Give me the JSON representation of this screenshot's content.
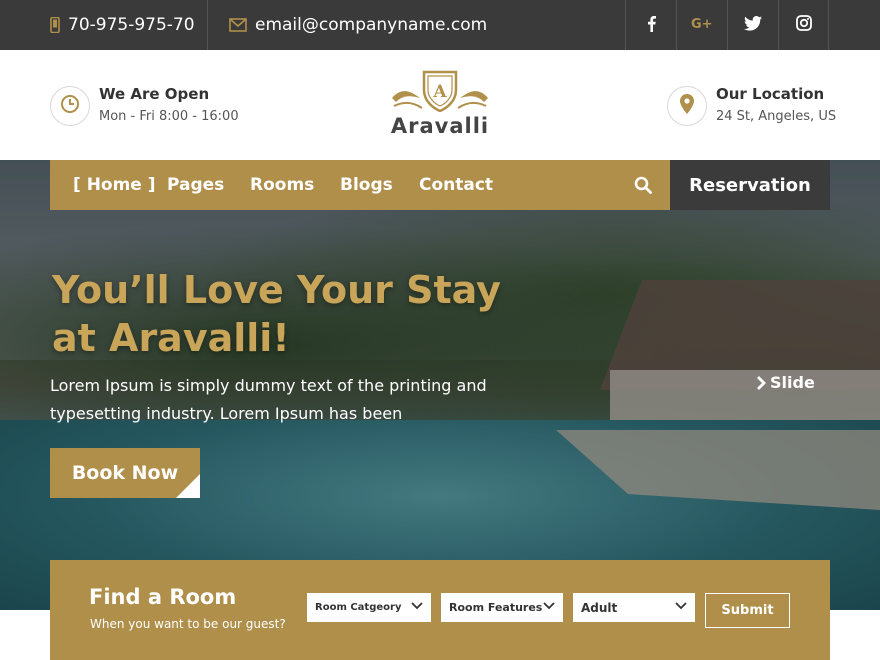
{
  "topbar": {
    "phone": "70-975-975-70",
    "email": "email@companyname.com",
    "social": [
      {
        "icon": "facebook-icon",
        "glyph": "f"
      },
      {
        "icon": "google-plus-icon",
        "glyph": "G+"
      },
      {
        "icon": "twitter-icon",
        "glyph": "t"
      },
      {
        "icon": "instagram-icon",
        "glyph": "ig"
      }
    ]
  },
  "header": {
    "hours_title": "We Are Open",
    "hours_text": "Mon - Fri 8:00 - 16:00",
    "logo_name": "Aravalli",
    "logo_badge": "A",
    "location_title": "Our Location",
    "location_text": "24 St, Angeles, US"
  },
  "nav": {
    "items": [
      "[ Home ]",
      "Pages",
      "Rooms",
      "Blogs",
      "Contact"
    ],
    "reservation": "Reservation"
  },
  "hero": {
    "headline_line1": "You’ll Love Your Stay",
    "headline_line2": "at Aravalli!",
    "lead": "Lorem Ipsum is simply dummy text of the printing and typesetting industry. Lorem Ipsum has been",
    "cta": "Book Now",
    "slide": "Slide"
  },
  "finder": {
    "title": "Find a Room",
    "subtitle": "When you want to be our guest?",
    "selects": [
      "Room Catgeory",
      "Room Features",
      "Adult"
    ],
    "submit": "Submit"
  },
  "colors": {
    "accent": "#b08f4b",
    "dark": "#3a3a3a",
    "headline": "#c9a55a"
  }
}
